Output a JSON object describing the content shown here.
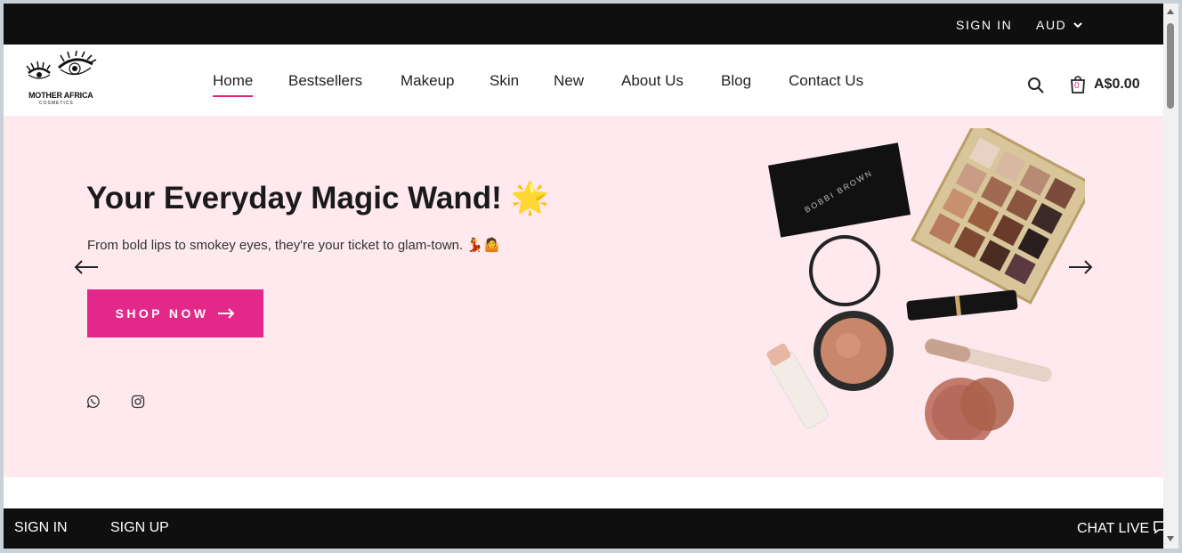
{
  "topbar": {
    "signin_label": "SIGN IN",
    "currency": "AUD"
  },
  "brand": {
    "name": "MOTHER AFRICA",
    "tagline": "COSMETICS"
  },
  "nav": {
    "items": [
      {
        "label": "Home",
        "active": true
      },
      {
        "label": "Bestsellers"
      },
      {
        "label": "Makeup"
      },
      {
        "label": "Skin"
      },
      {
        "label": "New"
      },
      {
        "label": "About Us"
      },
      {
        "label": "Blog"
      },
      {
        "label": "Contact Us"
      }
    ]
  },
  "cart": {
    "count": "0",
    "total": "A$0.00"
  },
  "hero": {
    "title": "Your Everyday Magic Wand! 🌟",
    "subtitle": "From bold lips to smokey eyes, they're your ticket to glam-town.  💃🤷",
    "cta_label": "SHOP NOW"
  },
  "social": [
    "whatsapp-icon",
    "instagram-icon"
  ],
  "bottombar": {
    "signin_label": "SIGN IN",
    "signup_label": "SIGN UP",
    "chat_label": "CHAT LIVE"
  },
  "colors": {
    "accent": "#e3288a",
    "hero_bg": "#fde9ee",
    "bar_bg": "#0f0f0f"
  }
}
